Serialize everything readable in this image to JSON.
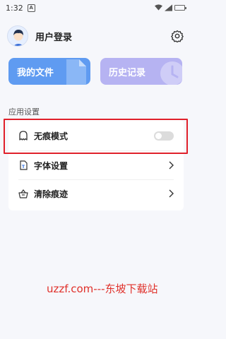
{
  "status_bar": {
    "time": "1:32",
    "notification_icon": "A"
  },
  "header": {
    "title": "用户登录",
    "avatar": "user-avatar",
    "settings_icon": "gear-icon"
  },
  "cards": {
    "files_label": "我的文件",
    "history_label": "历史记录"
  },
  "settings": {
    "section_label": "应用设置",
    "items": [
      {
        "label": "无痕模式",
        "icon": "ghost-icon",
        "type": "toggle",
        "enabled": false
      },
      {
        "label": "字体设置",
        "icon": "font-file-icon",
        "type": "link"
      },
      {
        "label": "清除痕迹",
        "icon": "basket-icon",
        "type": "link"
      }
    ]
  },
  "watermark": "uzzf.com---东坡下载站",
  "colors": {
    "files_card": "#5f9bf1",
    "history_card": "#b6b3f2",
    "highlight": "#e0202a",
    "watermark": "#e0302a"
  }
}
